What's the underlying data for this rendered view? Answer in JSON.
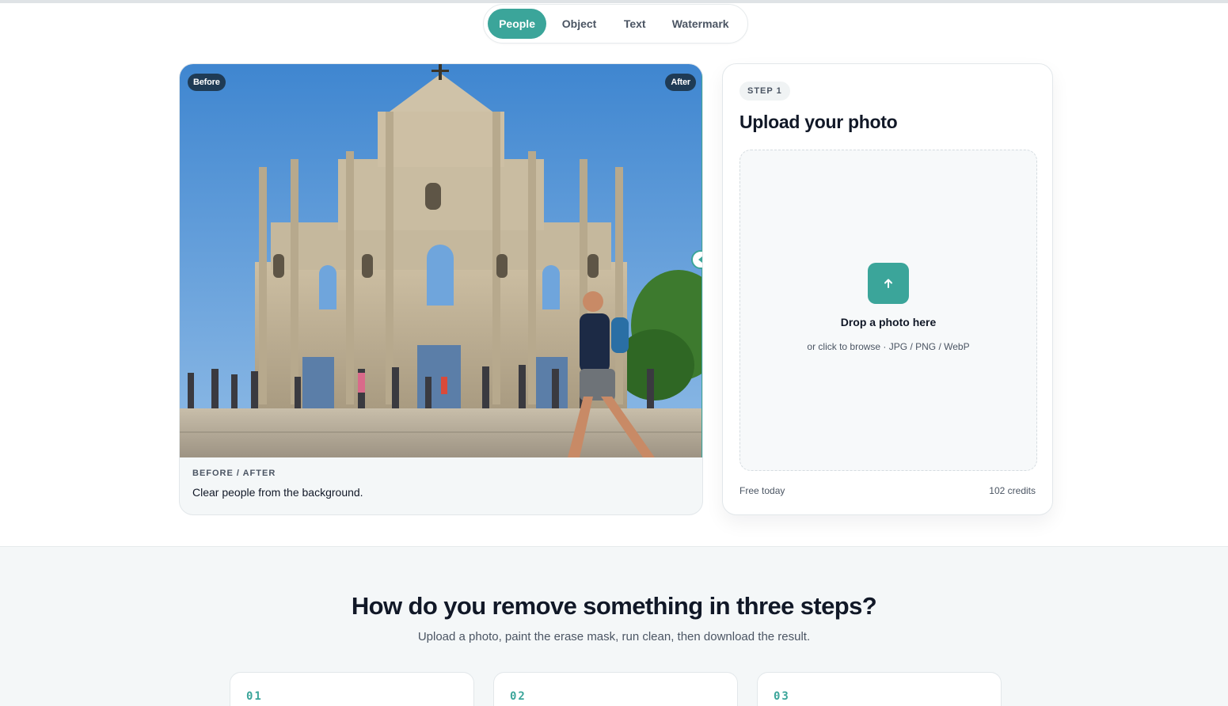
{
  "tabs": {
    "items": [
      {
        "label": "People",
        "active": true
      },
      {
        "label": "Object",
        "active": false
      },
      {
        "label": "Text",
        "active": false
      },
      {
        "label": "Watermark",
        "active": false
      }
    ]
  },
  "before_after": {
    "before_label": "Before",
    "after_label": "After",
    "eyebrow": "BEFORE / AFTER",
    "caption": "Clear people from the background.",
    "slider_position": 0.995
  },
  "upload": {
    "step_label": "STEP 1",
    "title": "Upload your photo",
    "drop_title": "Drop a photo here",
    "drop_subtitle": "or click to browse · JPG / PNG / WebP",
    "footer_left": "Free today",
    "footer_right": "102 credits",
    "upload_icon": "arrow-up-icon"
  },
  "steps_section": {
    "title": "How do you remove something in three steps?",
    "subtitle": "Upload a photo, paint the erase mask, run clean, then download the result.",
    "cards": [
      {
        "number": "01"
      },
      {
        "number": "02"
      },
      {
        "number": "03"
      }
    ]
  },
  "colors": {
    "accent": "#3ba59a",
    "pill_dark": "#1f3b55",
    "section_bg": "#f4f7f8"
  }
}
